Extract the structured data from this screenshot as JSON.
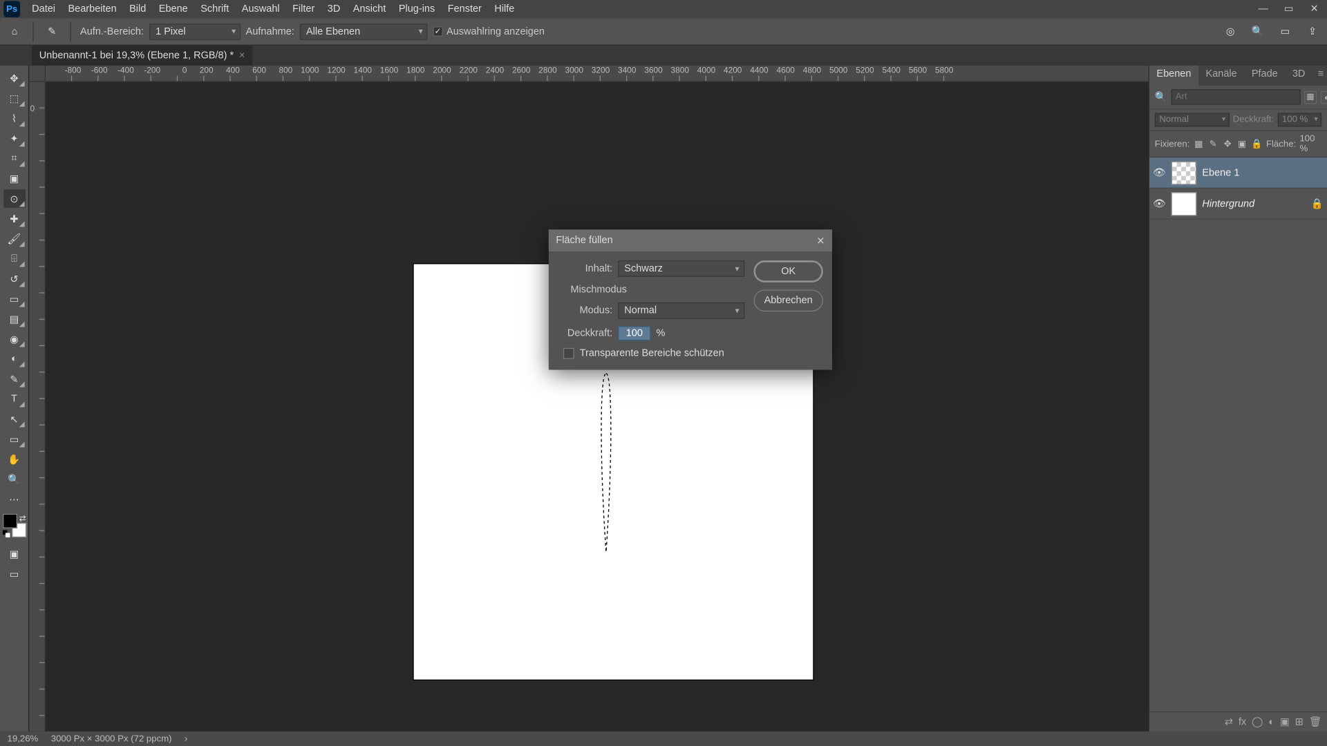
{
  "menubar": {
    "items": [
      "Datei",
      "Bearbeiten",
      "Bild",
      "Ebene",
      "Schrift",
      "Auswahl",
      "Filter",
      "3D",
      "Ansicht",
      "Plug-ins",
      "Fenster",
      "Hilfe"
    ]
  },
  "optionsbar": {
    "sample_area_label": "Aufn.-Bereich:",
    "sample_area_value": "1 Pixel",
    "sample_label": "Aufnahme:",
    "sample_value": "Alle Ebenen",
    "show_selection_label": "Auswahlring anzeigen"
  },
  "document_tab": {
    "title": "Unbenannt-1 bei 19,3% (Ebene 1, RGB/8) *"
  },
  "ruler": {
    "h_ticks": [
      "-800",
      "-600",
      "-400",
      "-200",
      "0",
      "200",
      "400",
      "600",
      "800",
      "1000",
      "1200",
      "1400",
      "1600",
      "1800",
      "2000",
      "2200",
      "2400",
      "2600",
      "2800",
      "3000",
      "3200",
      "3400",
      "3600",
      "3800",
      "4000",
      "4200",
      "4400",
      "4600",
      "4800",
      "5000",
      "5200",
      "5400",
      "5600",
      "5800"
    ],
    "v_ticks": [
      "0",
      "",
      "",
      "",
      "",
      "",
      "",
      "",
      "",
      "",
      "",
      "",
      "",
      "",
      "",
      "",
      "",
      "",
      "",
      "",
      "",
      "",
      "",
      "",
      ""
    ]
  },
  "dialog": {
    "title": "Fläche füllen",
    "content_label": "Inhalt:",
    "content_value": "Schwarz",
    "blend_section": "Mischmodus",
    "mode_label": "Modus:",
    "mode_value": "Normal",
    "opacity_label": "Deckkraft:",
    "opacity_value": "100",
    "opacity_unit": "%",
    "protect_label": "Transparente Bereiche schützen",
    "ok": "OK",
    "cancel": "Abbrechen"
  },
  "panels": {
    "tabs": [
      "Ebenen",
      "Kanäle",
      "Pfade",
      "3D"
    ],
    "search_placeholder": "Art",
    "blend_mode": "Normal",
    "opacity_label": "Deckkraft:",
    "opacity_value": "100 %",
    "lock_label": "Fixieren:",
    "fill_label": "Fläche:",
    "fill_value": "100 %",
    "layers": [
      {
        "name": "Ebene 1",
        "italic": false,
        "selected": true,
        "checker": true,
        "locked": false
      },
      {
        "name": "Hintergrund",
        "italic": true,
        "selected": false,
        "checker": false,
        "locked": true
      }
    ]
  },
  "status": {
    "zoom": "19,26%",
    "doc_info": "3000 Px × 3000 Px (72 ppcm)"
  }
}
